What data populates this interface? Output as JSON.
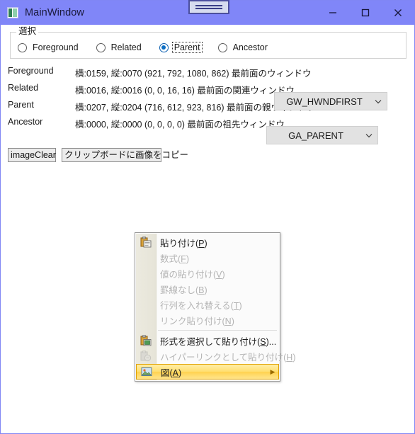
{
  "window": {
    "title": "MainWindow",
    "icon": "app-window-icon",
    "caption_buttons": [
      {
        "name": "minimize-button",
        "glyph": "minimize-icon"
      },
      {
        "name": "maximize-button",
        "glyph": "maximize-icon"
      },
      {
        "name": "close-button",
        "glyph": "close-icon"
      }
    ],
    "titlebar_color": "#8086f8",
    "border_color": "#8086f5",
    "float_handle": {
      "name": "floating-handle-widget"
    }
  },
  "groupbox": {
    "legend": "選択",
    "options": [
      {
        "label": "Foreground",
        "checked": false,
        "focused": false
      },
      {
        "label": "Related",
        "checked": false,
        "focused": false
      },
      {
        "label": "Parent",
        "checked": true,
        "focused": true
      },
      {
        "label": "Ancestor",
        "checked": false,
        "focused": false
      }
    ]
  },
  "rows": [
    {
      "name": "Foreground",
      "info": "横:0159, 縦:0070  (921, 792, 1080, 862) 最前面のウィンドウ",
      "combo": null
    },
    {
      "name": "Related",
      "info": "横:0016, 縦:0016  (0, 0, 16, 16) 最前面の関連ウィンドウ",
      "combo": {
        "value": "GW_HWNDFIRST",
        "id": "combo-related"
      }
    },
    {
      "name": "Parent",
      "info": "横:0207, 縦:0204  (716, 612, 923, 816) 最前面の親ウィンドウ",
      "combo": null
    },
    {
      "name": "Ancestor",
      "info": "横:0000, 縦:0000  (0, 0, 0, 0) 最前面の祖先ウィンドウ",
      "combo": {
        "value": "GA_PARENT",
        "id": "combo-ancestor"
      }
    }
  ],
  "buttons": [
    {
      "id": "btn-image-clear",
      "label": "imageClear"
    },
    {
      "id": "btn-copy-clip",
      "label": "クリップボードに画像をコピー"
    }
  ],
  "context_menu": {
    "items": [
      {
        "pre": "貼り付け(",
        "key": "P",
        "post": ")",
        "icon": "paste-icon",
        "disabled": false,
        "highlight": false,
        "submenu": false,
        "sep_before": false
      },
      {
        "pre": "数式(",
        "key": "F",
        "post": ")",
        "icon": null,
        "disabled": true,
        "highlight": false,
        "submenu": false,
        "sep_before": false
      },
      {
        "pre": "値の貼り付け(",
        "key": "V",
        "post": ")",
        "icon": null,
        "disabled": true,
        "highlight": false,
        "submenu": false,
        "sep_before": false
      },
      {
        "pre": "罫線なし(",
        "key": "B",
        "post": ")",
        "icon": null,
        "disabled": true,
        "highlight": false,
        "submenu": false,
        "sep_before": false
      },
      {
        "pre": "行列を入れ替える(",
        "key": "T",
        "post": ")",
        "icon": null,
        "disabled": true,
        "highlight": false,
        "submenu": false,
        "sep_before": false
      },
      {
        "pre": "リンク貼り付け(",
        "key": "N",
        "post": ")",
        "icon": null,
        "disabled": true,
        "highlight": false,
        "submenu": false,
        "sep_before": false
      },
      {
        "pre": "形式を選択して貼り付け(",
        "key": "S",
        "post": ")...",
        "icon": "paste-special-icon",
        "disabled": false,
        "highlight": false,
        "submenu": false,
        "sep_before": true
      },
      {
        "pre": "ハイパーリンクとして貼り付け(",
        "key": "H",
        "post": ")",
        "icon": "paste-hyperlink-icon",
        "disabled": true,
        "highlight": false,
        "submenu": false,
        "sep_before": false
      },
      {
        "pre": "図(",
        "key": "A",
        "post": ")",
        "icon": "picture-icon",
        "disabled": false,
        "highlight": true,
        "submenu": true,
        "sep_before": false
      }
    ],
    "submenu_arrow": "▶",
    "highlight_color": "#ffdf70"
  }
}
